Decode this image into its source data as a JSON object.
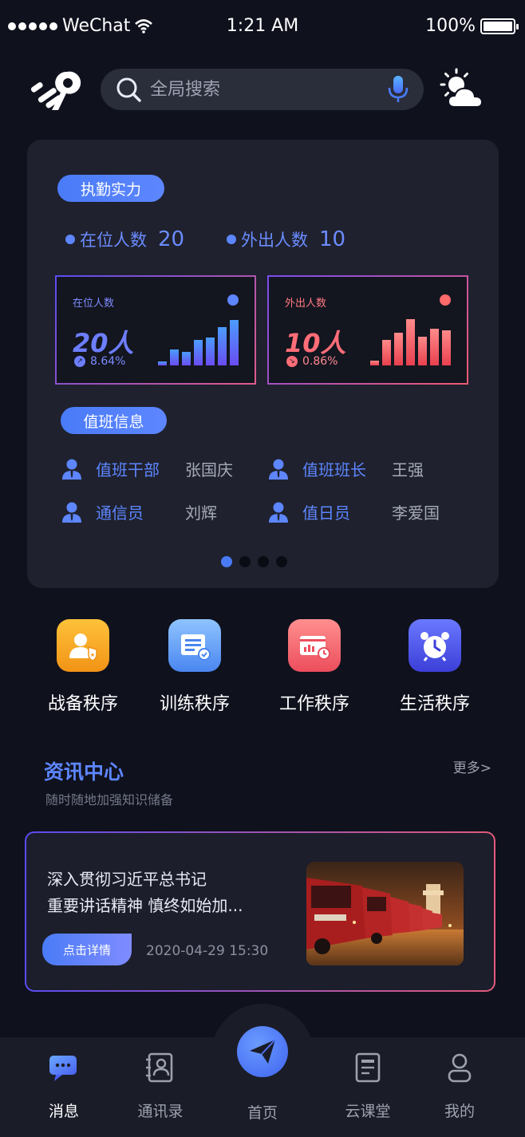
{
  "status_bar": {
    "carrier": "WeChat",
    "time": "1:21 AM",
    "battery": "100%"
  },
  "header": {
    "search_placeholder": "全局搜索"
  },
  "duty": {
    "strength_label": "执勤实力",
    "on_duty_label": "在位人数",
    "on_duty_count": "20",
    "out_label": "外出人数",
    "out_count": "10",
    "on_card": {
      "title": "在位人数",
      "value": "20人",
      "change": "8.64%",
      "bars": [
        0.08,
        0.35,
        0.3,
        0.55,
        0.6,
        0.82,
        0.98
      ]
    },
    "out_card": {
      "title": "外出人数",
      "value": "10人",
      "change": "0.86%",
      "bars": [
        0.1,
        0.55,
        0.7,
        1.0,
        0.62,
        0.8,
        0.75
      ]
    },
    "duty_info_label": "值班信息",
    "roster": [
      {
        "role": "值班干部",
        "name": "张国庆"
      },
      {
        "role": "值班班长",
        "name": "王强"
      },
      {
        "role": "通信员",
        "name": "刘辉"
      },
      {
        "role": "值日员",
        "name": "李爱国"
      }
    ]
  },
  "procedures": [
    {
      "label": "战备秩序",
      "icon": "shield-person-icon",
      "color": "#f7a21b"
    },
    {
      "label": "训练秩序",
      "icon": "document-check-icon",
      "color": "#5a9cf0"
    },
    {
      "label": "工作秩序",
      "icon": "chart-clock-icon",
      "color": "#f05a68"
    },
    {
      "label": "生活秩序",
      "icon": "alarm-clock-icon",
      "color": "#4a55e8"
    }
  ],
  "news": {
    "title": "资讯中心",
    "subtitle": "随时随地加强知识储备",
    "more": "更多>",
    "headline_line1": "深入贯彻习近平总书记",
    "headline_line2": "重要讲话精神 慎终如始加...",
    "detail_button": "点击详情",
    "date": "2020-04-29  15:30"
  },
  "tabs": [
    {
      "label": "消息",
      "icon": "chat-bubble-icon"
    },
    {
      "label": "通讯录",
      "icon": "contacts-icon"
    },
    {
      "label": "首页",
      "icon": "paper-plane-icon"
    },
    {
      "label": "云课堂",
      "icon": "document-icon"
    },
    {
      "label": "我的",
      "icon": "user-icon"
    }
  ],
  "colors": {
    "background": "#0f111d",
    "card": "#1f212e",
    "accent_blue": "#5d86ff",
    "accent_red": "#ff6d78"
  }
}
